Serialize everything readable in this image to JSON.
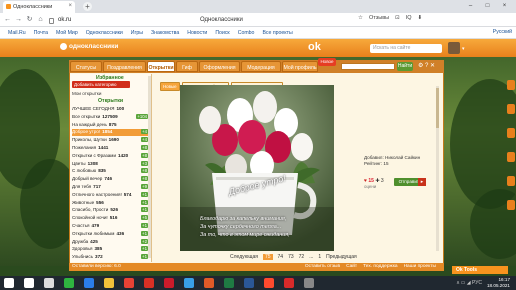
{
  "browser": {
    "tab_title": "Одноклассники",
    "url": "ok.ru",
    "page_title": "Одноклассники",
    "toolbar_items": [
      "☆",
      "Отзывы",
      "⊡",
      "IQ",
      "⬇"
    ]
  },
  "bookmarks": {
    "items": [
      "Mail.Ru",
      "Почта",
      "Мой Мир",
      "Одноклассники",
      "Игры",
      "Знакомства",
      "Новости",
      "Поиск",
      "Combo",
      "Все проекты"
    ],
    "right": "Русский"
  },
  "ok_header": {
    "logo_text": "одноклассники",
    "mid_logo": "ok",
    "search_placeholder": "Искать на сайте"
  },
  "tabs": [
    {
      "label": "Статусы",
      "active": false
    },
    {
      "label": "Поздравления",
      "active": false
    },
    {
      "label": "Открытки",
      "active": true
    },
    {
      "label": "Гиф",
      "active": false
    },
    {
      "label": "Оформления",
      "active": false
    },
    {
      "label": "Модерация",
      "active": false
    },
    {
      "label": "Мой профиль",
      "active": false
    }
  ],
  "notif_badge": "Новое",
  "search": {
    "button": "Найти"
  },
  "tab_controls": "⚙ ? ✕",
  "sidebar": {
    "favorites_header": "Избранное",
    "add_category": "Добавить категорию",
    "my_cards": "Мои открытки",
    "cards_header": "Открытки",
    "items": [
      {
        "label": "ЛУЧШЕЕ СЕГОДНЯ",
        "count": "100",
        "badge": ""
      },
      {
        "label": "Все открытки",
        "count": "127509",
        "badge": "+104"
      },
      {
        "label": "На каждый день",
        "count": "875",
        "badge": ""
      },
      {
        "label": "Доброе утро!",
        "count": "1854",
        "badge": "+4"
      },
      {
        "label": "Приколы, Шутки",
        "count": "1690",
        "badge": "+4"
      },
      {
        "label": "Пожелания",
        "count": "1441",
        "badge": "+8"
      },
      {
        "label": "Открытки с Фразами",
        "count": "1420",
        "badge": "+8"
      },
      {
        "label": "Цветы",
        "count": "1308",
        "badge": "+3"
      },
      {
        "label": "С любовью",
        "count": "835",
        "badge": "+8"
      },
      {
        "label": "Добрый вечер",
        "count": "746",
        "badge": "+8"
      },
      {
        "label": "Для тебя",
        "count": "717",
        "badge": "+9"
      },
      {
        "label": "Отличного настроения!",
        "count": "574",
        "badge": "+1"
      },
      {
        "label": "Животные",
        "count": "556",
        "badge": "+1"
      },
      {
        "label": "Спасибо, Прости",
        "count": "526",
        "badge": "+1"
      },
      {
        "label": "Спокойной ночи!",
        "count": "516",
        "badge": "+5"
      },
      {
        "label": "Счастья",
        "count": "479",
        "badge": "+1"
      },
      {
        "label": "Открытки любимым",
        "count": "436",
        "badge": "+1"
      },
      {
        "label": "Дружба",
        "count": "425",
        "badge": "+2"
      },
      {
        "label": "Здоровья",
        "count": "385",
        "badge": "+1"
      },
      {
        "label": "Улыбнись",
        "count": "372",
        "badge": "+1"
      }
    ],
    "selected_index": 3
  },
  "filters": [
    {
      "label": "Новые",
      "on": true
    },
    {
      "label": "Лучшие по рейтингу",
      "on": false
    },
    {
      "label": "Лучшие по установкам",
      "on": false
    }
  ],
  "card": {
    "greeting": "Доброе утро!",
    "verse": [
      "Благодарю за капельку внимания,",
      "За чуточку сердечного тепла...",
      "За то, что в этом мире ожидания,"
    ],
    "author_label": "Добавил: Николай Сайкин",
    "rating_label": "Рейтинг: 15",
    "votes": [
      "15",
      "3"
    ],
    "vote_label": "оцени",
    "send_button": "Отправить"
  },
  "pager": {
    "prev": "Следующая",
    "pages": [
      "75",
      "74",
      "73",
      "72",
      "...",
      "1"
    ],
    "current": "75",
    "next": "Предыдущая"
  },
  "footer": {
    "version": "Оставили версию: 6.0",
    "links": [
      "Оставить отзыв",
      "Сайт",
      "Тех. поддержка",
      "Наши проекты"
    ]
  },
  "ok_tools": "Ok Tools",
  "taskbar": {
    "time": "16:17",
    "date": "18.05.2021",
    "tray": "ʌ ▭ ◢ РУС",
    "apps": [
      {
        "name": "start",
        "color": "#ffffff"
      },
      {
        "name": "search",
        "color": "#ffffff"
      },
      {
        "name": "task-view",
        "color": "#dddddd"
      },
      {
        "name": "app-green",
        "color": "#2fb440"
      },
      {
        "name": "app-blue",
        "color": "#2b7de9"
      },
      {
        "name": "explorer",
        "color": "#f3c13a"
      },
      {
        "name": "chrome",
        "color": "#e94235"
      },
      {
        "name": "app-red",
        "color": "#d93025"
      },
      {
        "name": "opera",
        "color": "#cc1b2b"
      },
      {
        "name": "photos",
        "color": "#39a0e8"
      },
      {
        "name": "media",
        "color": "#e05a28"
      },
      {
        "name": "excel",
        "color": "#1f7a43"
      },
      {
        "name": "word",
        "color": "#2b5797"
      },
      {
        "name": "yandex",
        "color": "#ff4a2e"
      },
      {
        "name": "app-red-2",
        "color": "#d92a2a"
      },
      {
        "name": "settings",
        "color": "#888888"
      }
    ]
  }
}
